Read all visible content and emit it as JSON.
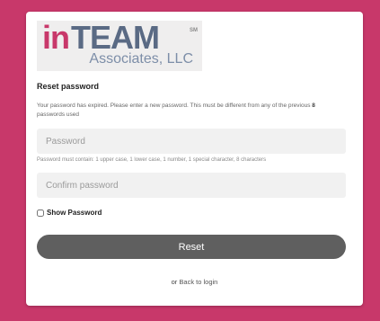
{
  "brand": {
    "logo_in": "in",
    "logo_team": "TEAM",
    "logo_sm": "SM",
    "logo_sub": "Associates, LLC",
    "colors": {
      "in": "#c8386a",
      "team": "#5a6a84",
      "background": "#c8386a"
    }
  },
  "form": {
    "title": "Reset password",
    "info_pre": "Your password has expired. Please enter a new password. This must be different from any of the previous ",
    "info_count": "8",
    "info_post": " passwords used",
    "password_placeholder": "Password",
    "password_value": "",
    "requirements": "Password must contain: 1 upper case, 1 lower case, 1 number, 1 special character, 8 characters",
    "confirm_placeholder": "Confirm password",
    "confirm_value": "",
    "show_password_label": "Show Password",
    "show_password_checked": false,
    "reset_button": "Reset"
  },
  "footer": {
    "or_text": "or",
    "back_link": "Back to login"
  }
}
